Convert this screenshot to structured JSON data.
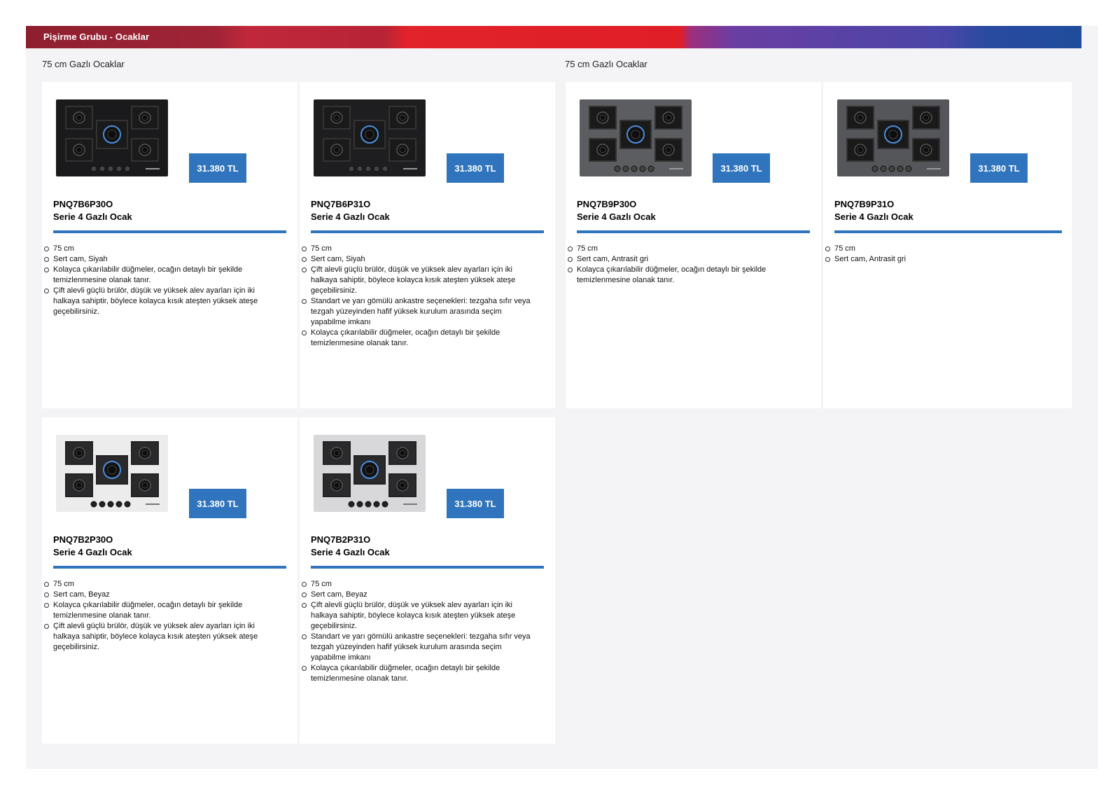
{
  "banner": {
    "title": "Pişirme Grubu - Ocaklar"
  },
  "sections": [
    "75 cm Gazlı Ocaklar",
    "75 cm Gazlı Ocaklar"
  ],
  "products": [
    {
      "price": "31.380 TL",
      "model": "PNQ7B6P30O",
      "name": "Serie 4 Gazlı Ocak",
      "glass_color": "#1a1a1c",
      "features": [
        "75 cm",
        "Sert cam, Siyah",
        "Kolayca çıkarılabilir düğmeler, ocağın detaylı bir şekilde temizlenmesine olanak tanır.",
        "Çift alevli güçlü brülör, düşük ve yüksek alev ayarları için iki halkaya sahiptir, böylece kolayca kısık ateşten yüksek ateşe geçebilirsiniz."
      ]
    },
    {
      "price": "31.380 TL",
      "model": "PNQ7B6P31O",
      "name": "Serie 4 Gazlı Ocak",
      "glass_color": "#1e1e20",
      "features": [
        "75 cm",
        "Sert cam, Siyah",
        "Çift alevli güçlü brülör, düşük ve yüksek alev ayarları için iki halkaya sahiptir, böylece kolayca kısık ateşten yüksek ateşe geçebilirsiniz.",
        "Standart ve yarı gömülü ankastre seçenekleri: tezgaha sıfır veya tezgah yüzeyinden hafif yüksek kurulum arasında seçim yapabilme imkanı",
        "Kolayca çıkarılabilir düğmeler, ocağın detaylı bir şekilde temizlenmesine olanak tanır."
      ]
    },
    {
      "price": "31.380 TL",
      "model": "PNQ7B9P30O",
      "name": "Serie 4 Gazlı Ocak",
      "glass_color": "#5c5d60",
      "features": [
        "75 cm",
        "Sert cam, Antrasit gri",
        "Kolayca çıkarılabilir düğmeler, ocağın detaylı bir şekilde temizlenmesine olanak tanır."
      ]
    },
    {
      "price": "31.380 TL",
      "model": "PNQ7B9P31O",
      "name": "Serie 4 Gazlı Ocak",
      "glass_color": "#55565a",
      "features": [
        "75 cm",
        "Sert cam, Antrasit gri"
      ]
    },
    {
      "price": "31.380 TL",
      "model": "PNQ7B2P30O",
      "name": "Serie 4 Gazlı Ocak",
      "glass_color": "#ececec",
      "features": [
        "75 cm",
        "Sert cam, Beyaz",
        "Kolayca çıkarılabilir düğmeler, ocağın detaylı bir şekilde temizlenmesine olanak tanır.",
        "Çift alevli güçlü brülör, düşük ve yüksek alev ayarları için iki halkaya sahiptir, böylece kolayca kısık ateşten yüksek ateşe geçebilirsiniz."
      ]
    },
    {
      "price": "31.380 TL",
      "model": "PNQ7B2P31O",
      "name": "Serie 4 Gazlı Ocak",
      "glass_color": "#d8d8da",
      "features": [
        "75 cm",
        "Sert cam, Beyaz",
        "Çift alevli güçlü brülör, düşük ve yüksek alev ayarları için iki halkaya sahiptir, böylece kolayca kısık ateşten yüksek ateşe geçebilirsiniz.",
        "Standart ve yarı gömülü ankastre seçenekleri: tezgaha sıfır veya tezgah yüzeyinden hafif yüksek kurulum arasında seçim yapabilme imkanı",
        "Kolayca çıkarılabilir düğmeler, ocağın detaylı bir şekilde temizlenmesine olanak tanır."
      ]
    }
  ]
}
